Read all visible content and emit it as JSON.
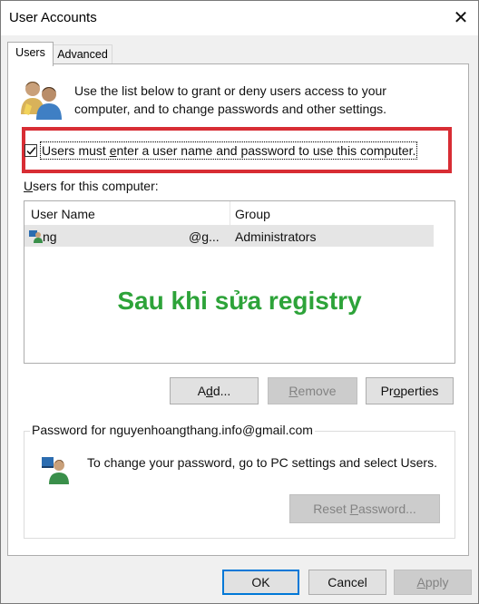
{
  "window": {
    "title": "User Accounts",
    "close_glyph": "✕"
  },
  "tabs": [
    {
      "label": "Users",
      "selected": true
    },
    {
      "label": "Advanced",
      "selected": false
    }
  ],
  "intro_text": "Use the list below to grant or deny users access to your computer, and to change passwords and other settings.",
  "require_login": {
    "checked": true,
    "pre": "Users must ",
    "underlined": "e",
    "post": "nter a user name and password to use this computer."
  },
  "users_list": {
    "label_underlined": "U",
    "label_rest": "sers for this computer:",
    "columns": [
      "User Name",
      "Group"
    ],
    "rows": [
      {
        "name": "ng",
        "name_tail": "@g...",
        "group": "Administrators"
      }
    ]
  },
  "annotation": {
    "text": "Sau khi sửa registry",
    "color": "#2da339"
  },
  "buttons": {
    "add": {
      "pre": "A",
      "underlined": "d",
      "post": "d...",
      "enabled": true
    },
    "remove": {
      "underlined": "R",
      "post": "emove",
      "enabled": false
    },
    "properties": {
      "pre": "Pr",
      "underlined": "o",
      "post": "perties",
      "enabled": true
    }
  },
  "password": {
    "group_label": "Password for nguyenhoangthang.info@gmail.com",
    "text": "To change your password, go to PC settings and select Users.",
    "reset_pre": "Reset ",
    "reset_underlined": "P",
    "reset_post": "assword...",
    "reset_enabled": false
  },
  "footer": {
    "ok": "OK",
    "cancel": "Cancel",
    "apply_underlined": "A",
    "apply_post": "pply",
    "apply_enabled": false
  },
  "colors": {
    "highlight_border": "#d82d34",
    "focus_border": "#0078d7"
  },
  "icons": [
    "users-icon",
    "user-row-icon",
    "password-user-icon",
    "checkmark-icon",
    "close-icon"
  ]
}
